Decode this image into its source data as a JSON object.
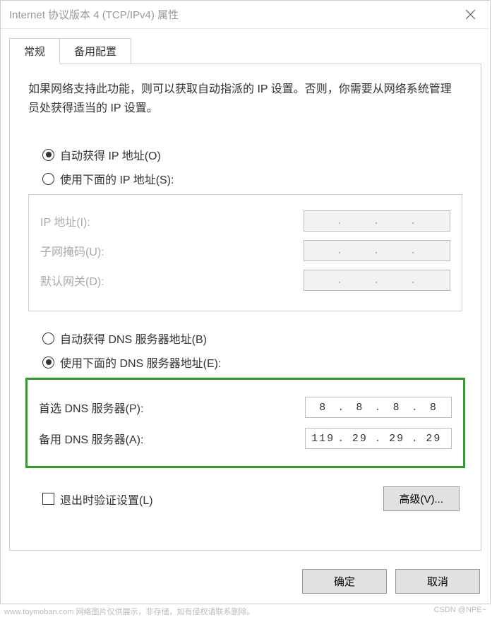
{
  "window": {
    "title": "Internet 协议版本 4 (TCP/IPv4) 属性"
  },
  "tabs": {
    "general": "常规",
    "alternate": "备用配置"
  },
  "description": "如果网络支持此功能，则可以获取自动指派的 IP 设置。否则，你需要从网络系统管理员处获得适当的 IP 设置。",
  "ip_section": {
    "auto_label": "自动获得 IP 地址(O)",
    "manual_label": "使用下面的 IP 地址(S):",
    "ip_address_label": "IP 地址(I):",
    "subnet_label": "子网掩码(U):",
    "gateway_label": "默认网关(D):",
    "ip_address_value": "",
    "subnet_value": "",
    "gateway_value": ""
  },
  "dns_section": {
    "auto_label": "自动获得 DNS 服务器地址(B)",
    "manual_label": "使用下面的 DNS 服务器地址(E):",
    "preferred_label": "首选 DNS 服务器(P):",
    "alternate_label": "备用 DNS 服务器(A):",
    "preferred_value": [
      "8",
      "8",
      "8",
      "8"
    ],
    "alternate_value": [
      "119",
      "29",
      "29",
      "29"
    ]
  },
  "validate_label": "退出时验证设置(L)",
  "advanced_btn": "高级(V)...",
  "ok_btn": "确定",
  "cancel_btn": "取消",
  "watermark_left": "www.toymoban.com  网络图片仅供展示，非存储，如有侵权请联系删除。",
  "watermark_right": "CSDN @NPE~"
}
